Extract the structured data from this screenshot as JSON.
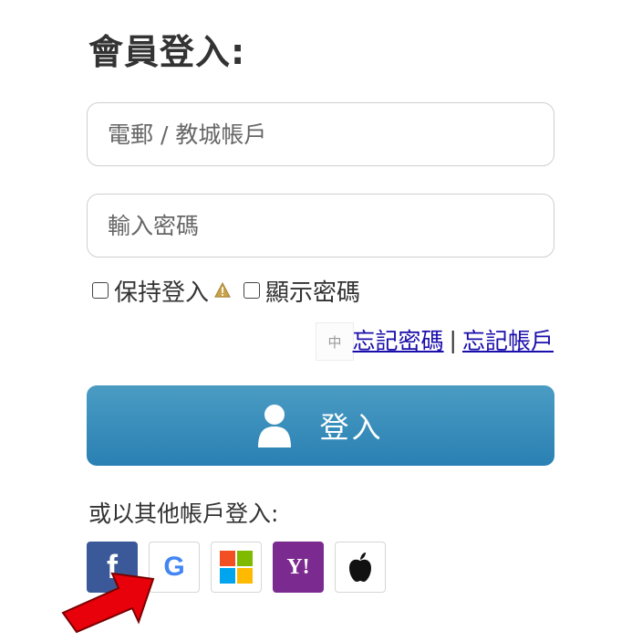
{
  "page": {
    "title": "會員登入:"
  },
  "form": {
    "account_placeholder": "電郵 / 教城帳戶",
    "password_placeholder": "輸入密碼",
    "remember_label": "保持登入",
    "show_password_label": "顯示密碼",
    "forgot_password": "忘記密碼",
    "separator": "|",
    "forgot_account": "忘記帳戶",
    "submit_label": "登入"
  },
  "ime_indicator": "中",
  "social": {
    "heading": "或以其他帳戶登入:",
    "providers": [
      {
        "name": "Facebook",
        "icon": "facebook-icon",
        "glyph": "f",
        "color": "#3b5998"
      },
      {
        "name": "Google",
        "icon": "google-icon",
        "glyph": "G",
        "color": "#4285f4"
      },
      {
        "name": "Microsoft",
        "icon": "microsoft-icon",
        "glyph": "",
        "color": "#f25022"
      },
      {
        "name": "Yahoo",
        "icon": "yahoo-icon",
        "glyph": "Y!",
        "color": "#7b2a8f"
      },
      {
        "name": "Apple",
        "icon": "apple-icon",
        "glyph": "",
        "color": "#000000"
      }
    ]
  },
  "colors": {
    "button_top": "#4a9cc3",
    "button_bottom": "#2a80b3",
    "link": "#1a0dab",
    "annotation_arrow": "#e8000b"
  }
}
